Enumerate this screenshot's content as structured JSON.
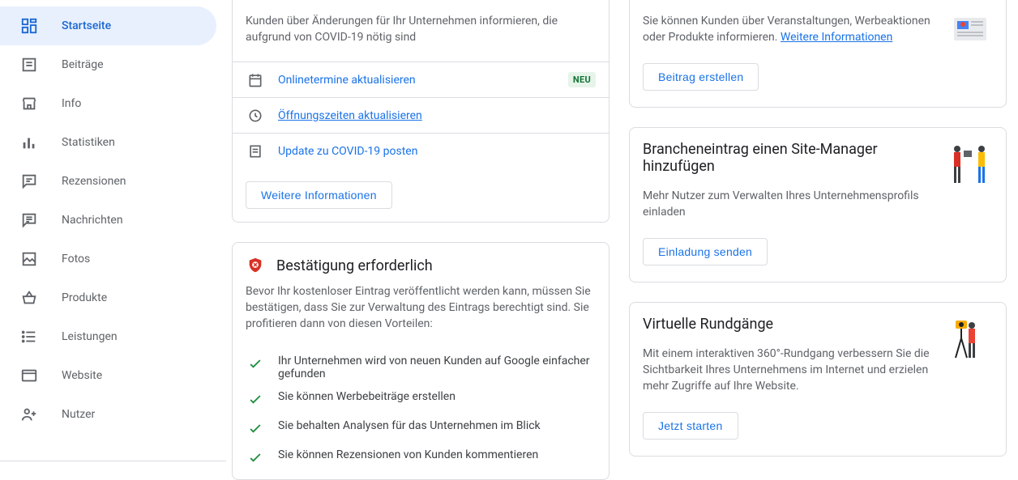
{
  "sidebar": {
    "items": [
      {
        "id": "home",
        "label": "Startseite"
      },
      {
        "id": "posts",
        "label": "Beiträge"
      },
      {
        "id": "info",
        "label": "Info"
      },
      {
        "id": "stats",
        "label": "Statistiken"
      },
      {
        "id": "reviews",
        "label": "Rezensionen"
      },
      {
        "id": "messages",
        "label": "Nachrichten"
      },
      {
        "id": "photos",
        "label": "Fotos"
      },
      {
        "id": "products",
        "label": "Produkte"
      },
      {
        "id": "services",
        "label": "Leistungen"
      },
      {
        "id": "website",
        "label": "Website"
      },
      {
        "id": "users",
        "label": "Nutzer"
      }
    ]
  },
  "covid_card": {
    "intro": "Kunden über Änderungen für Ihr Unternehmen informieren, die aufgrund von COVID-19 nötig sind",
    "rows": [
      {
        "label": "Onlinetermine aktualisieren",
        "badge": "NEU"
      },
      {
        "label": "Öffnungszeiten aktualisieren"
      },
      {
        "label": "Update zu COVID-19 posten"
      }
    ],
    "button": "Weitere Informationen"
  },
  "verify_card": {
    "title": "Bestätigung erforderlich",
    "intro": "Bevor Ihr kostenloser Eintrag veröffentlicht werden kann, müssen Sie bestätigen, dass Sie zur Verwaltung des Eintrags berechtigt sind. Sie profitieren dann von diesen Vorteilen:",
    "benefits": [
      "Ihr Unternehmen wird von neuen Kunden auf Google einfacher gefunden",
      "Sie können Werbebeiträge erstellen",
      "Sie behalten Analysen für das Unternehmen im Blick",
      "Sie können Rezensionen von Kunden kommentieren"
    ]
  },
  "posts_card": {
    "intro_a": "Sie können Kunden über Veranstaltungen, Werbeaktionen oder Produkte informieren. ",
    "link": "Weitere Informationen",
    "button": "Beitrag erstellen"
  },
  "manager_card": {
    "title": "Brancheneintrag einen Site-Manager hinzufügen",
    "intro": "Mehr Nutzer zum Verwalten Ihres Unternehmensprofils einladen",
    "button": "Einladung senden"
  },
  "tour_card": {
    "title": "Virtuelle Rundgänge",
    "intro": "Mit einem interaktiven 360°-Rundgang verbessern Sie die Sichtbarkeit Ihres Unternehmens im Internet und erzielen mehr Zugriffe auf Ihre Website.",
    "button": "Jetzt starten"
  }
}
